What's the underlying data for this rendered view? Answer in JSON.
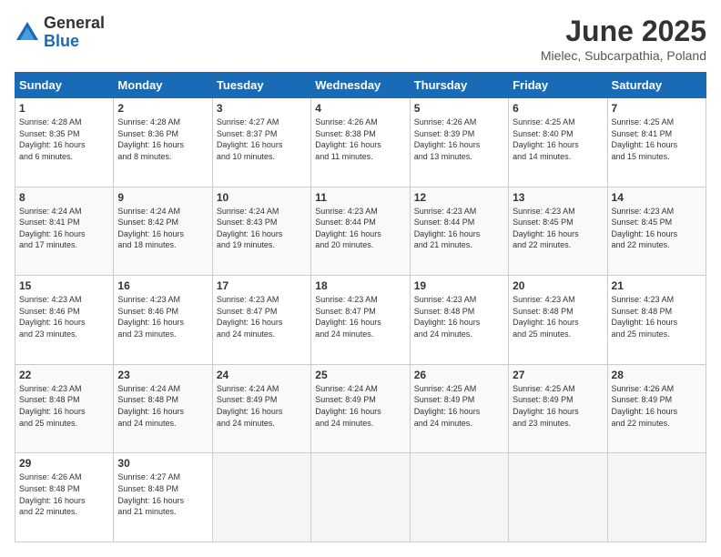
{
  "logo": {
    "general": "General",
    "blue": "Blue"
  },
  "title": "June 2025",
  "subtitle": "Mielec, Subcarpathia, Poland",
  "days_header": [
    "Sunday",
    "Monday",
    "Tuesday",
    "Wednesday",
    "Thursday",
    "Friday",
    "Saturday"
  ],
  "weeks": [
    [
      {
        "num": "1",
        "info": "Sunrise: 4:28 AM\nSunset: 8:35 PM\nDaylight: 16 hours\nand 6 minutes."
      },
      {
        "num": "2",
        "info": "Sunrise: 4:28 AM\nSunset: 8:36 PM\nDaylight: 16 hours\nand 8 minutes."
      },
      {
        "num": "3",
        "info": "Sunrise: 4:27 AM\nSunset: 8:37 PM\nDaylight: 16 hours\nand 10 minutes."
      },
      {
        "num": "4",
        "info": "Sunrise: 4:26 AM\nSunset: 8:38 PM\nDaylight: 16 hours\nand 11 minutes."
      },
      {
        "num": "5",
        "info": "Sunrise: 4:26 AM\nSunset: 8:39 PM\nDaylight: 16 hours\nand 13 minutes."
      },
      {
        "num": "6",
        "info": "Sunrise: 4:25 AM\nSunset: 8:40 PM\nDaylight: 16 hours\nand 14 minutes."
      },
      {
        "num": "7",
        "info": "Sunrise: 4:25 AM\nSunset: 8:41 PM\nDaylight: 16 hours\nand 15 minutes."
      }
    ],
    [
      {
        "num": "8",
        "info": "Sunrise: 4:24 AM\nSunset: 8:41 PM\nDaylight: 16 hours\nand 17 minutes."
      },
      {
        "num": "9",
        "info": "Sunrise: 4:24 AM\nSunset: 8:42 PM\nDaylight: 16 hours\nand 18 minutes."
      },
      {
        "num": "10",
        "info": "Sunrise: 4:24 AM\nSunset: 8:43 PM\nDaylight: 16 hours\nand 19 minutes."
      },
      {
        "num": "11",
        "info": "Sunrise: 4:23 AM\nSunset: 8:44 PM\nDaylight: 16 hours\nand 20 minutes."
      },
      {
        "num": "12",
        "info": "Sunrise: 4:23 AM\nSunset: 8:44 PM\nDaylight: 16 hours\nand 21 minutes."
      },
      {
        "num": "13",
        "info": "Sunrise: 4:23 AM\nSunset: 8:45 PM\nDaylight: 16 hours\nand 22 minutes."
      },
      {
        "num": "14",
        "info": "Sunrise: 4:23 AM\nSunset: 8:45 PM\nDaylight: 16 hours\nand 22 minutes."
      }
    ],
    [
      {
        "num": "15",
        "info": "Sunrise: 4:23 AM\nSunset: 8:46 PM\nDaylight: 16 hours\nand 23 minutes."
      },
      {
        "num": "16",
        "info": "Sunrise: 4:23 AM\nSunset: 8:46 PM\nDaylight: 16 hours\nand 23 minutes."
      },
      {
        "num": "17",
        "info": "Sunrise: 4:23 AM\nSunset: 8:47 PM\nDaylight: 16 hours\nand 24 minutes."
      },
      {
        "num": "18",
        "info": "Sunrise: 4:23 AM\nSunset: 8:47 PM\nDaylight: 16 hours\nand 24 minutes."
      },
      {
        "num": "19",
        "info": "Sunrise: 4:23 AM\nSunset: 8:48 PM\nDaylight: 16 hours\nand 24 minutes."
      },
      {
        "num": "20",
        "info": "Sunrise: 4:23 AM\nSunset: 8:48 PM\nDaylight: 16 hours\nand 25 minutes."
      },
      {
        "num": "21",
        "info": "Sunrise: 4:23 AM\nSunset: 8:48 PM\nDaylight: 16 hours\nand 25 minutes."
      }
    ],
    [
      {
        "num": "22",
        "info": "Sunrise: 4:23 AM\nSunset: 8:48 PM\nDaylight: 16 hours\nand 25 minutes."
      },
      {
        "num": "23",
        "info": "Sunrise: 4:24 AM\nSunset: 8:48 PM\nDaylight: 16 hours\nand 24 minutes."
      },
      {
        "num": "24",
        "info": "Sunrise: 4:24 AM\nSunset: 8:49 PM\nDaylight: 16 hours\nand 24 minutes."
      },
      {
        "num": "25",
        "info": "Sunrise: 4:24 AM\nSunset: 8:49 PM\nDaylight: 16 hours\nand 24 minutes."
      },
      {
        "num": "26",
        "info": "Sunrise: 4:25 AM\nSunset: 8:49 PM\nDaylight: 16 hours\nand 24 minutes."
      },
      {
        "num": "27",
        "info": "Sunrise: 4:25 AM\nSunset: 8:49 PM\nDaylight: 16 hours\nand 23 minutes."
      },
      {
        "num": "28",
        "info": "Sunrise: 4:26 AM\nSunset: 8:49 PM\nDaylight: 16 hours\nand 22 minutes."
      }
    ],
    [
      {
        "num": "29",
        "info": "Sunrise: 4:26 AM\nSunset: 8:48 PM\nDaylight: 16 hours\nand 22 minutes."
      },
      {
        "num": "30",
        "info": "Sunrise: 4:27 AM\nSunset: 8:48 PM\nDaylight: 16 hours\nand 21 minutes."
      },
      {
        "num": "",
        "info": ""
      },
      {
        "num": "",
        "info": ""
      },
      {
        "num": "",
        "info": ""
      },
      {
        "num": "",
        "info": ""
      },
      {
        "num": "",
        "info": ""
      }
    ]
  ]
}
